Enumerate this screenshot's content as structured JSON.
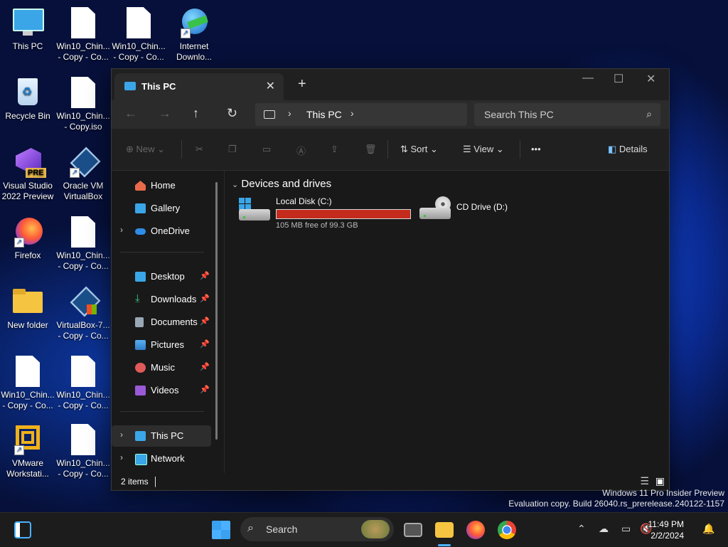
{
  "desktop": {
    "icons": [
      {
        "label": "This PC"
      },
      {
        "label": "Win10_Chin... - Copy - Co..."
      },
      {
        "label": "Win10_Chin... - Copy - Co..."
      },
      {
        "label": "Internet Downlo..."
      },
      {
        "label": "Recycle Bin"
      },
      {
        "label": "Win10_Chin... - Copy.iso"
      },
      {
        "label": "Visual Studio 2022 Preview"
      },
      {
        "label": "Oracle VM VirtualBox"
      },
      {
        "label": "Firefox"
      },
      {
        "label": "Win10_Chin... - Copy - Co..."
      },
      {
        "label": "New folder"
      },
      {
        "label": "VirtualBox-7... - Copy - Co..."
      },
      {
        "label": "Win10_Chin... - Copy - Co..."
      },
      {
        "label": "Win10_Chin... - Copy - Co..."
      },
      {
        "label": "VMware Workstati..."
      },
      {
        "label": "Win10_Chin... - Copy - Co..."
      }
    ],
    "vs_badge": "PRE"
  },
  "explorer": {
    "tab_title": "This PC",
    "address": {
      "crumb": "This PC"
    },
    "search_placeholder": "Search This PC",
    "commands": {
      "new": "New",
      "sort": "Sort",
      "view": "View",
      "more": "•••",
      "details": "Details"
    },
    "sidebar": {
      "home": "Home",
      "gallery": "Gallery",
      "onedrive": "OneDrive",
      "desktop": "Desktop",
      "downloads": "Downloads",
      "documents": "Documents",
      "pictures": "Pictures",
      "music": "Music",
      "videos": "Videos",
      "thispc": "This PC",
      "network": "Network"
    },
    "group_title": "Devices and drives",
    "drives": [
      {
        "name": "Local Disk (C:)",
        "free_text": "105 MB free of 99.3 GB",
        "used_fraction": 0.999
      },
      {
        "name": "CD Drive (D:)"
      }
    ],
    "status": {
      "count": "2 items"
    }
  },
  "watermark": {
    "line1": "Windows 11 Pro Insider Preview",
    "line2": "Evaluation copy. Build 26040.rs_prerelease.240122-1157"
  },
  "taskbar": {
    "search_placeholder": "Search",
    "time": "11:49 PM",
    "date": "2/2/2024"
  },
  "colors": {
    "accent": "#3aa6e8",
    "drive_bar": "#c42b1c"
  }
}
